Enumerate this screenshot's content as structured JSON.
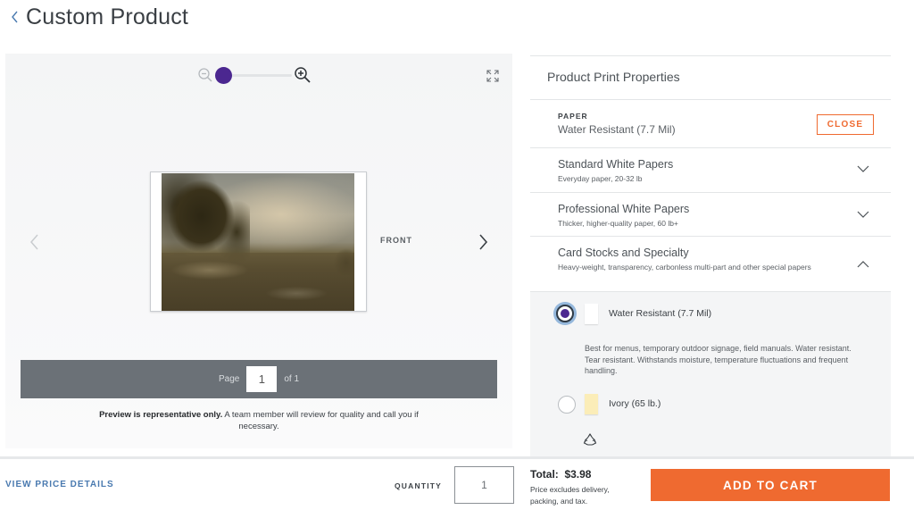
{
  "header": {
    "back_icon": "chevron-left-icon",
    "title": "Custom Product"
  },
  "preview": {
    "zoom": {
      "zoom_out_icon": "zoom-out-icon",
      "zoom_in_icon": "zoom-in-icon",
      "level": 0,
      "thumb_color": "#4b2790"
    },
    "fullscreen_icon": "expand-icon",
    "prev_icon": "chevron-left-icon",
    "next_icon": "chevron-right-icon",
    "side_label": "FRONT",
    "image_description": "Landscape painting with trees and cloudy sky",
    "pager": {
      "page_label": "Page",
      "page_value": "1",
      "of_label": "of 1"
    },
    "note_bold": "Preview is representative only.",
    "note_text": " A team member will review for quality and call you if necessary."
  },
  "properties": {
    "title": "Product Print Properties",
    "paper": {
      "label": "PAPER",
      "value": "Water Resistant (7.7 Mil)",
      "close_label": "CLOSE"
    },
    "categories": [
      {
        "title": "Standard White Papers",
        "subtitle": "Everyday paper, 20-32 lb",
        "expanded": false,
        "icon": "chevron-down-icon"
      },
      {
        "title": "Professional White Papers",
        "subtitle": "Thicker, higher-quality paper, 60 lb+",
        "expanded": false,
        "icon": "chevron-down-icon"
      },
      {
        "title": "Card Stocks and Specialty",
        "subtitle": "Heavy-weight, transparency, carbonless multi-part and other special papers",
        "expanded": true,
        "icon": "chevron-up-icon"
      }
    ],
    "options": [
      {
        "label": "Water Resistant (7.7 Mil)",
        "selected": true,
        "swatch_color": "#ffffff",
        "description": "Best for menus, temporary outdoor signage, field manuals. Water resistant. Tear resistant. Withstands moisture, temperature fluctuations and frequent handling."
      },
      {
        "label": "Ivory (65 lb.)",
        "selected": false,
        "swatch_color": "#fbedb8",
        "icon": "recycle-icon"
      }
    ]
  },
  "footer": {
    "price_details_label": "VIEW PRICE DETAILS",
    "quantity_label": "QUANTITY",
    "quantity_value": "1",
    "total_label": "Total:  $3.98",
    "total_note": "Price excludes delivery, packing, and tax.",
    "add_to_cart_label": "ADD TO CART",
    "accent_color": "#ef6a30",
    "link_color": "#4a7ab0"
  }
}
